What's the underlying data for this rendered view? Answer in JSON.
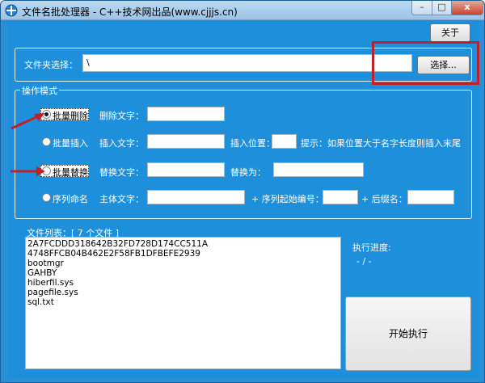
{
  "window": {
    "title": "文件名批处理器 - C++技术网出品(www.cjjjs.cn)",
    "controls": {
      "minimize": "–",
      "maximize": "□",
      "close": "x"
    }
  },
  "toolbar": {
    "about_label": "关于"
  },
  "folder": {
    "label": "文件夹选择：",
    "value": "\\",
    "browse_label": "选择..."
  },
  "mode": {
    "legend": "操作模式",
    "options": [
      {
        "label": "批量删除",
        "checked": true
      },
      {
        "label": "批量插入",
        "checked": false
      },
      {
        "label": "批量替换",
        "checked": false
      },
      {
        "label": "序列命名",
        "checked": false
      }
    ],
    "delete": {
      "text_label": "删除文字：",
      "text_value": ""
    },
    "insert": {
      "text_label": "插入文字：",
      "text_value": "",
      "pos_label": "插入位置：",
      "pos_value": "",
      "hint": "提示：如果位置大于名字长度则插入末尾"
    },
    "replace": {
      "text_label": "替换文字：",
      "text_value": "",
      "with_label": "替换为：",
      "with_value": ""
    },
    "sequence": {
      "main_label": "主体文字：",
      "main_value": "",
      "start_label": "+ 序列起始编号：",
      "start_value": "",
      "suffix_label": "+ 后缀名：",
      "suffix_value": ""
    }
  },
  "filelist": {
    "label": "文件列表：[ 7 个文件 ]",
    "items": [
      "2A7FCDDD318642B32FD728D174CC511A",
      "4748FFCB04B462E2F58FB1DFBEFE2939",
      "bootmgr",
      "GAHBY",
      "hiberfil.sys",
      "pagefile.sys",
      "sql.txt"
    ]
  },
  "progress": {
    "label": "执行进度:",
    "value": "- / -"
  },
  "run": {
    "label": "开始执行"
  },
  "colors": {
    "client_bg": "#1e8fdb",
    "annotation_red": "#c0202a"
  }
}
